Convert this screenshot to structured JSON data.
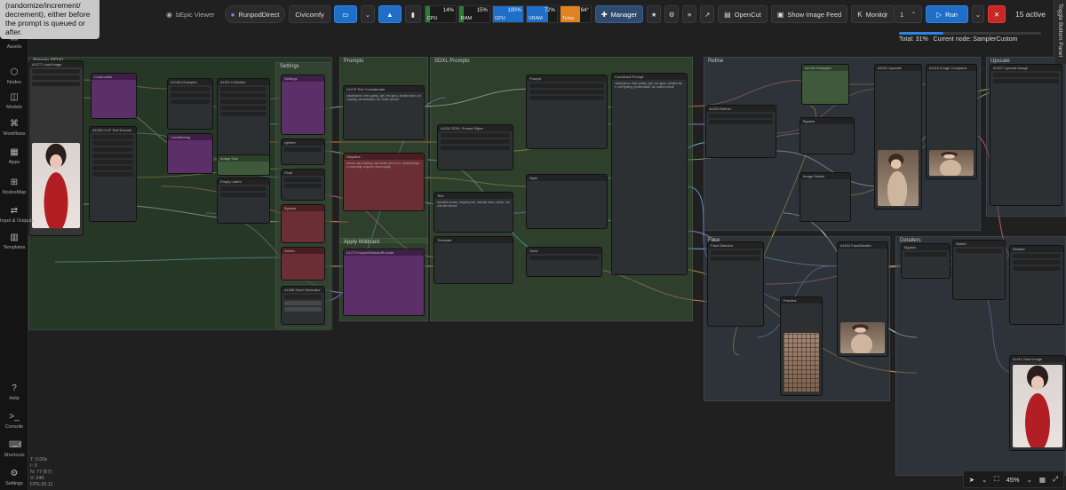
{
  "tooltip": {
    "text": "(randomize/increment/ decrement), either before the prompt is queued or after."
  },
  "sidebar": {
    "items": [
      {
        "label": "Assets",
        "icon": "folder-icon"
      },
      {
        "label": "Nodes",
        "icon": "nodes-icon"
      },
      {
        "label": "Models",
        "icon": "cube-icon"
      },
      {
        "label": "Workflows",
        "icon": "workflow-icon"
      },
      {
        "label": "Apps",
        "icon": "apps-icon"
      },
      {
        "label": "NodesMap",
        "icon": "map-icon"
      },
      {
        "label": "Input & Outputs",
        "icon": "inout-icon"
      },
      {
        "label": "Templates",
        "icon": "templates-icon"
      }
    ],
    "bottom": [
      {
        "label": "Help",
        "icon": "help-icon"
      },
      {
        "label": "Console",
        "icon": "console-icon"
      },
      {
        "label": "Shortcuts",
        "icon": "keyboard-icon"
      },
      {
        "label": "Settings",
        "icon": "gear-icon"
      }
    ]
  },
  "stats": {
    "t": "T: 0.00s",
    "i": "I: 0",
    "n": "N: 77 [67]",
    "v": "V: 246",
    "fps": "FPS:33.11"
  },
  "toolbar": {
    "viewer": "bEpic Viewer",
    "runpod": "RunpodDirect",
    "civicomfy": "Civicomfy",
    "meters": [
      {
        "label": "CPU",
        "value": "14%",
        "fill": 0.14,
        "color": "#2e7d32"
      },
      {
        "label": "RAM",
        "value": "15%",
        "fill": 0.15,
        "color": "#2e7d32"
      },
      {
        "label": "GPU",
        "value": "100%",
        "fill": 1.0,
        "color": "#1f6fc9"
      },
      {
        "label": "VRAM",
        "value": "72%",
        "fill": 0.72,
        "color": "#1f6fc9"
      },
      {
        "label": "Temp",
        "value": "64°",
        "fill": 0.64,
        "color": "#e0821f"
      }
    ],
    "manager": "Manager",
    "opencut": "OpenCut",
    "show_feed": "Show Image Feed",
    "monitor": "Monitor"
  },
  "run": {
    "count": "1",
    "label": "Run",
    "active": "15 active"
  },
  "progress": {
    "fraction": 0.31,
    "total": "Total: 31%",
    "current": "Current node: SamplerCustom"
  },
  "queue_tab": "Toggle Bottom Panel",
  "zoom": {
    "level": "45%"
  },
  "groups": [
    {
      "title": "Simple SDXL",
      "color": "#2e4a2c"
    },
    {
      "title": "Settings",
      "color": "#3a4a38"
    },
    {
      "title": "Prompts",
      "color": "#3a5a36"
    },
    {
      "title": "SDXL Prompts",
      "color": "#3a5a36"
    },
    {
      "title": "Apply Wildcard",
      "color": "#3a5a36"
    },
    {
      "title": "Refine",
      "color": "#37414a"
    },
    {
      "title": "Upscale",
      "color": "#37414a"
    },
    {
      "title": "Face",
      "color": "#37414a"
    },
    {
      "title": "Detailers",
      "color": "#37414a"
    }
  ],
  "node_titles": {
    "load_image": "#1277 Load Image",
    "clip_text": "#1283 CLIP Text Encode",
    "ksampler": "#1246 KSampler",
    "preview": "#1260 Preview Image",
    "upscale": "#1307 Upscale Image",
    "face_detailer": "#1402 FaceDetailer",
    "sdxl_prompt": "#1231 SDXL Prompt Styler",
    "text_concat": "#1279 Text Concatenate",
    "wildcard": "#1273 ImpactWildcardEncode",
    "seed": "#1268 Seed Generator",
    "image_compare": "#1410 Image Comparer",
    "save": "#1411 Save Image"
  },
  "node_text": {
    "prompt_text": "masterpiece, best quality, 1girl, red qipao, detailed face, soft lighting, photorealistic, 8k, studio portrait",
    "negative_text": "lowres, bad anatomy, bad hands, text, error, missing fingers, extra digit, cropped, worst quality",
    "wildcard_text": "beautiful woman, elegant pose, intricate dress, bokeh, natural skin texture"
  }
}
